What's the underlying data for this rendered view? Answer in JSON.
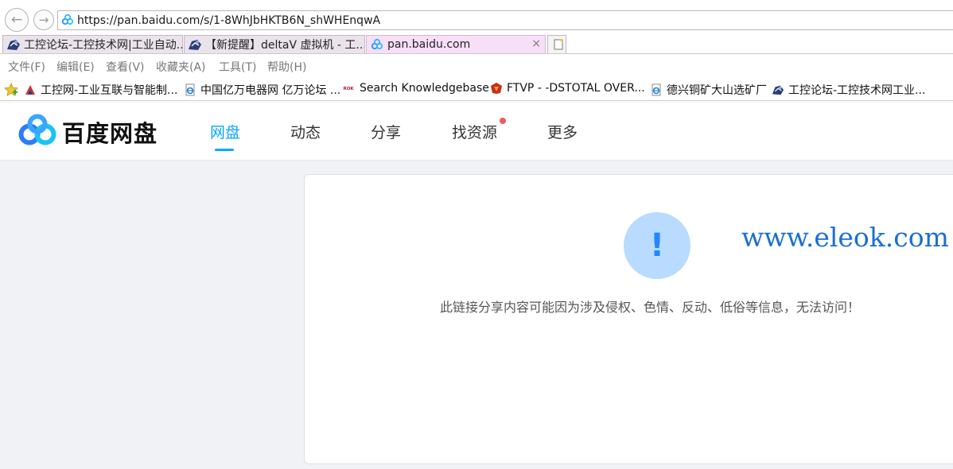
{
  "browser": {
    "url": "https://pan.baidu.com/s/1-8WhJbHKTB6N_shWHEnqwA",
    "back_glyph": "←",
    "forward_glyph": "→",
    "tabs": [
      {
        "label": "工控论坛-工控技术网|工业自动..."
      },
      {
        "label": "【新提醒】deltaV 虚拟机 - 工..."
      },
      {
        "label": "pan.baidu.com",
        "close": "×"
      }
    ],
    "menu": [
      "文件(F)",
      "编辑(E)",
      "查看(V)",
      "收藏夹(A)",
      "工具(T)",
      "帮助(H)"
    ],
    "favorites": [
      {
        "label": "工控网-工业互联与智能制...",
        "icon": "gongkong-icon"
      },
      {
        "label": "中国亿万电器网 亿万论坛 ...",
        "icon": "ie-page-icon"
      },
      {
        "label": "Search Knowledgebase",
        "icon": "rok-icon",
        "icon_text": "ROK"
      },
      {
        "label": "FTVP - -DSTOTAL OVER...",
        "icon": "ftvp-icon"
      },
      {
        "label": "德兴铜矿大山选矿厂",
        "icon": "ie-page-icon"
      },
      {
        "label": "工控论坛-工控技术网工业...",
        "icon": "gongkong-icon"
      }
    ]
  },
  "site": {
    "logo_text": "百度网盘",
    "nav": [
      {
        "label": "网盘",
        "active": true
      },
      {
        "label": "动态"
      },
      {
        "label": "分享"
      },
      {
        "label": "找资源",
        "badge": "red-dot"
      },
      {
        "label": "更多"
      }
    ],
    "accent_color": "#06a7ff"
  },
  "content": {
    "alert_symbol": "!",
    "watermark": "www.eleok.com",
    "message": "此链接分享内容可能因为涉及侵权、色情、反动、低俗等信息，无法访问！"
  }
}
